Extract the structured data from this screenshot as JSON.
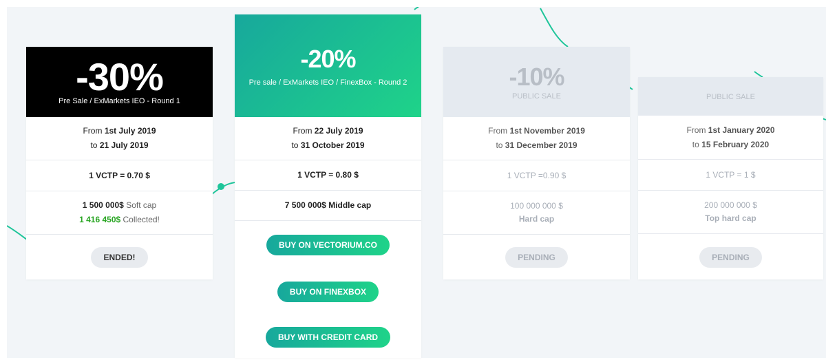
{
  "cards": [
    {
      "discount": "-30%",
      "subtitle": "Pre Sale / ExMarkets IEO - Round 1",
      "dates": {
        "from_label": "From",
        "from": "1st July 2019",
        "to_label": "to",
        "to": "21 July 2019"
      },
      "rate": "1 VCTP = 0.70 $",
      "cap": {
        "amount": "1 500 000$",
        "label": "Soft cap",
        "collected_amount": "1 416 450$",
        "collected_label": "Collected!"
      },
      "button": "ENDED!"
    },
    {
      "discount": "-20%",
      "subtitle": "Pre sale / ExMarkets IEO / FinexBox - Round 2",
      "dates": {
        "from_label": "From",
        "from": "22 July 2019",
        "to_label": "to",
        "to": "31 October 2019"
      },
      "rate": "1 VCTP = 0.80 $",
      "cap": {
        "amount": "7 500 000$",
        "label": "Middle cap"
      },
      "buttons": [
        "BUY ON VECTORIUM.CO",
        "BUY ON FINEXBOX",
        "BUY WITH CREDIT CARD"
      ]
    },
    {
      "discount": "-10%",
      "subtitle": "PUBLIC SALE",
      "dates": {
        "from_label": "From",
        "from": "1st November 2019",
        "to_label": "to",
        "to": "31 December 2019"
      },
      "rate": "1 VCTP =0.90 $",
      "cap": {
        "amount": "100 000 000 $",
        "label": "Hard cap"
      },
      "button": "PENDING"
    },
    {
      "subtitle": "PUBLIC SALE",
      "dates": {
        "from_label": "From",
        "from": "1st January 2020",
        "to_label": "to",
        "to": "15 February 2020"
      },
      "rate": "1 VCTP = 1 $",
      "cap": {
        "amount": "200 000 000 $",
        "label": "Top hard cap"
      },
      "button": "PENDING"
    }
  ],
  "colors": {
    "accent_green": "#1fd389",
    "teal": "#17a89c",
    "collected_green": "#2aa624",
    "background": "#f2f5f8"
  }
}
